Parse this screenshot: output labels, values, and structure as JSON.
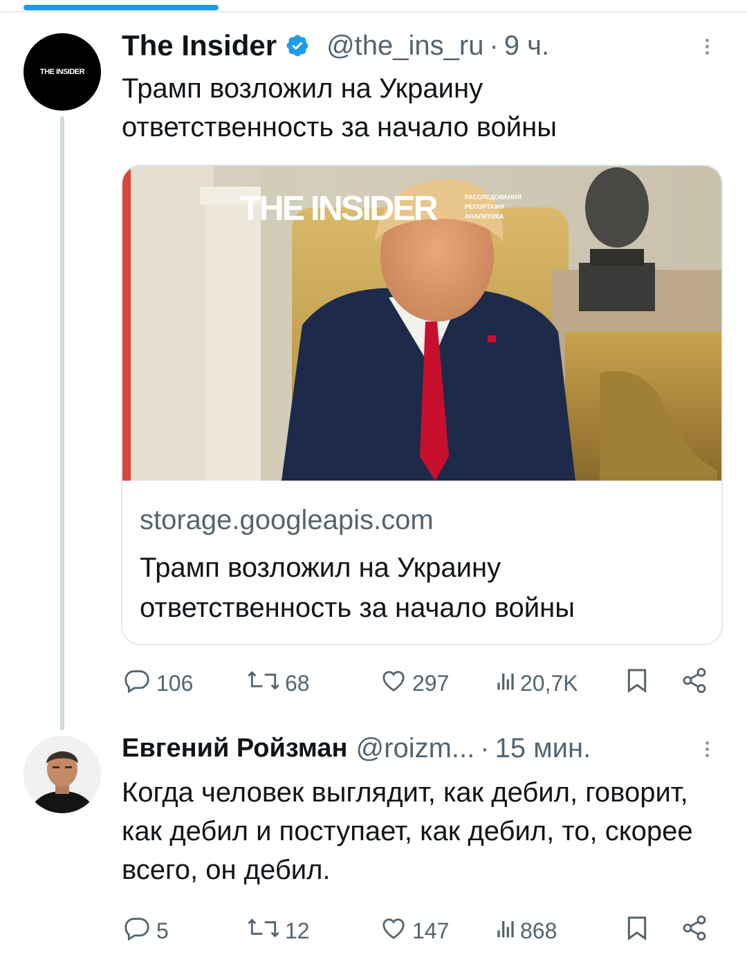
{
  "colors": {
    "accent": "#1d9bf0",
    "muted": "#536471",
    "line": "#cfd9de",
    "tie": "#c8102e"
  },
  "tweets": [
    {
      "author": "The Insider",
      "avatar_text": "THE INSIDER",
      "handle": "@the_ins_ru",
      "time": "9 ч.",
      "text": "Трамп возложил на Украину ответственность за начало войны",
      "card": {
        "logo": "THE INSIDER",
        "taglines": [
          "РАССЛЕДОВАНИЯ",
          "РЕПОРТАЖИ",
          "АНАЛИТИКА"
        ],
        "domain": "storage.googleapis.com",
        "title": "Трамп возложил на Украину ответственность за начало войны"
      },
      "stats": {
        "replies": "106",
        "retweets": "68",
        "likes": "297",
        "views": "20,7K"
      }
    },
    {
      "author": "Евгений Ройзман",
      "handle": "@roizm...",
      "time": "15 мин.",
      "text": "Когда человек выглядит, как дебил, говорит, как дебил и поступает, как дебил, то, скорее всего, он дебил.",
      "stats": {
        "replies": "5",
        "retweets": "12",
        "likes": "147",
        "views": "868"
      }
    }
  ],
  "icons": [
    "verified-icon",
    "more-icon",
    "reply-icon",
    "retweet-icon",
    "like-icon",
    "views-icon",
    "bookmark-icon",
    "share-icon"
  ]
}
